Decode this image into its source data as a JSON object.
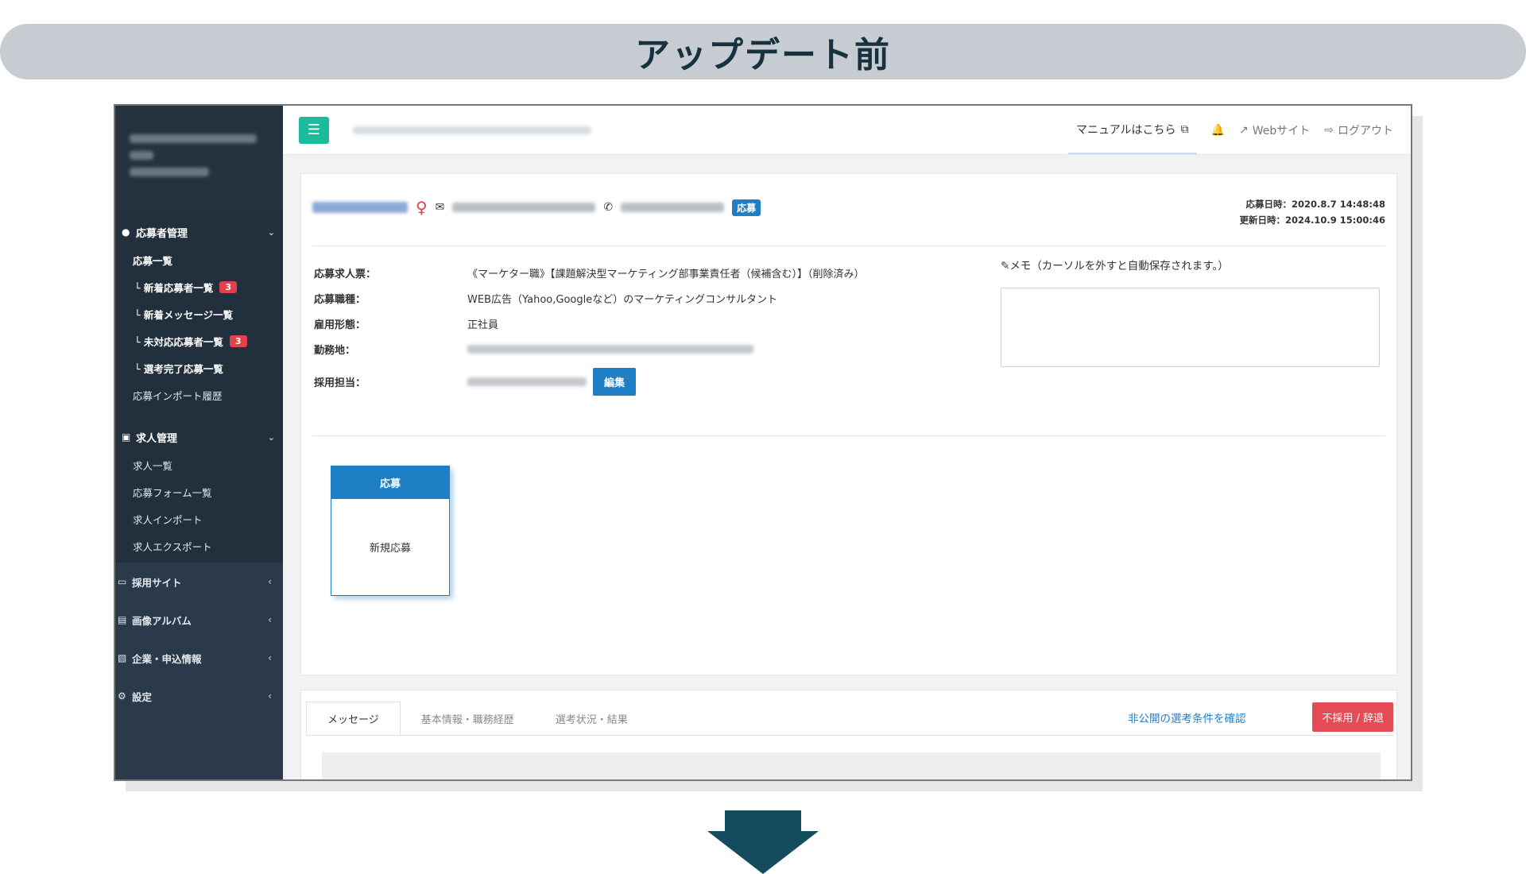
{
  "banner": {
    "title": "アップデート前"
  },
  "sidebar": {
    "sections": {
      "applicants": {
        "title": "応募者管理",
        "items": [
          {
            "label": "応募一覧"
          },
          {
            "label": "└ 新着応募者一覧",
            "badge": "3"
          },
          {
            "label": "└ 新着メッセージ一覧"
          },
          {
            "label": "└ 未対応応募者一覧",
            "badge": "3"
          },
          {
            "label": "└ 選考完了応募一覧"
          },
          {
            "label": "応募インポート履歴"
          }
        ]
      },
      "jobs": {
        "title": "求人管理",
        "items": [
          {
            "label": "求人一覧"
          },
          {
            "label": "応募フォーム一覧"
          },
          {
            "label": "求人インポート"
          },
          {
            "label": "求人エクスポート"
          }
        ]
      }
    },
    "collapsed": [
      {
        "label": "採用サイト"
      },
      {
        "label": "画像アルバム"
      },
      {
        "label": "企業・申込情報"
      },
      {
        "label": "設定"
      }
    ]
  },
  "topbar": {
    "manual": "マニュアルはこちら",
    "website": "Webサイト",
    "logout": "ログアウト"
  },
  "applicant": {
    "status_tag": "応募",
    "applied_at": "応募日時：2020.8.7 14:48:48",
    "updated_at": "更新日時：2024.10.9 15:00:46"
  },
  "details": {
    "job_label": "応募求人票：",
    "job_value": "《マーケター職》【課題解決型マーケティング部事業責任者（候補含む）】（削除済み）",
    "role_label": "応募職種：",
    "role_value": "WEB広告（Yahoo,Googleなど）のマーケティングコンサルタント",
    "employment_label": "雇用形態：",
    "employment_value": "正社員",
    "location_label": "勤務地：",
    "owner_label": "採用担当：",
    "edit_button": "編集"
  },
  "memo": {
    "label": "メモ（カーソルを外すと自動保存されます。）"
  },
  "status_card": {
    "head": "応募",
    "body": "新規応募"
  },
  "tabs": [
    {
      "label": "メッセージ"
    },
    {
      "label": "基本情報・職務経歴"
    },
    {
      "label": "選考状況・結果"
    }
  ],
  "actions": {
    "confirm_link": "非公開の選考条件を確認",
    "reject_button": "不採用 / 辞退"
  },
  "colors": {
    "sidebar": "#2b3a4a",
    "accent_blue": "#1f7fc4",
    "accent_teal": "#1abc9c",
    "danger": "#e54b55",
    "banner_bg": "#c7ccd2",
    "banner_text": "#16323f"
  }
}
